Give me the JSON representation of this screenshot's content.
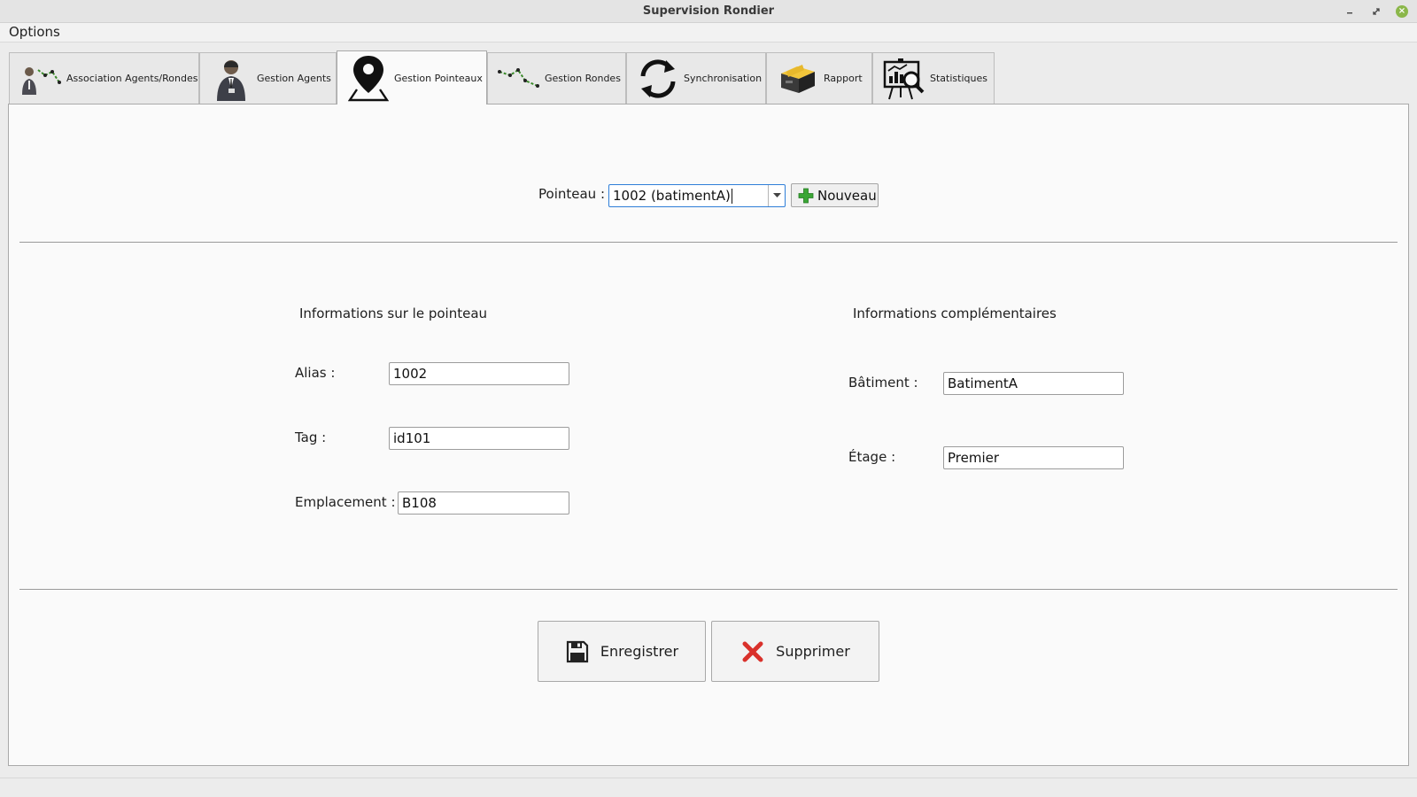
{
  "window": {
    "title": "Supervision Rondier"
  },
  "menu": {
    "options_label": "Options"
  },
  "tabs": [
    {
      "label": "Association Agents/Rondes",
      "icon": "agent-route-icon"
    },
    {
      "label": "Gestion Agents",
      "icon": "agent-icon"
    },
    {
      "label": "Gestion Pointeaux",
      "icon": "map-pin-icon",
      "active": true
    },
    {
      "label": "Gestion Rondes",
      "icon": "route-icon"
    },
    {
      "label": "Synchronisation",
      "icon": "sync-icon"
    },
    {
      "label": "Rapport",
      "icon": "archive-box-icon"
    },
    {
      "label": "Statistiques",
      "icon": "statistics-icon"
    }
  ],
  "pointeau_selector": {
    "label": "Pointeau :",
    "value": "1002 (batimentA)",
    "new_button_label": "Nouveau"
  },
  "info_section": {
    "heading": "Informations sur le pointeau",
    "alias_label": "Alias :",
    "alias_value": "1002",
    "tag_label": "Tag :",
    "tag_value": "id101",
    "location_label": "Emplacement :",
    "location_value": "B108"
  },
  "extra_section": {
    "heading": "Informations complémentaires",
    "building_label": "Bâtiment :",
    "building_value": "BatimentA",
    "floor_label": "Étage :",
    "floor_value": "Premier"
  },
  "actions": {
    "save_label": "Enregistrer",
    "delete_label": "Supprimer"
  },
  "colors": {
    "accent_focus": "#2f7ed8",
    "add_icon_green": "#3aa635",
    "delete_icon_red": "#d9312b",
    "window_close_green": "#8bb74a"
  }
}
